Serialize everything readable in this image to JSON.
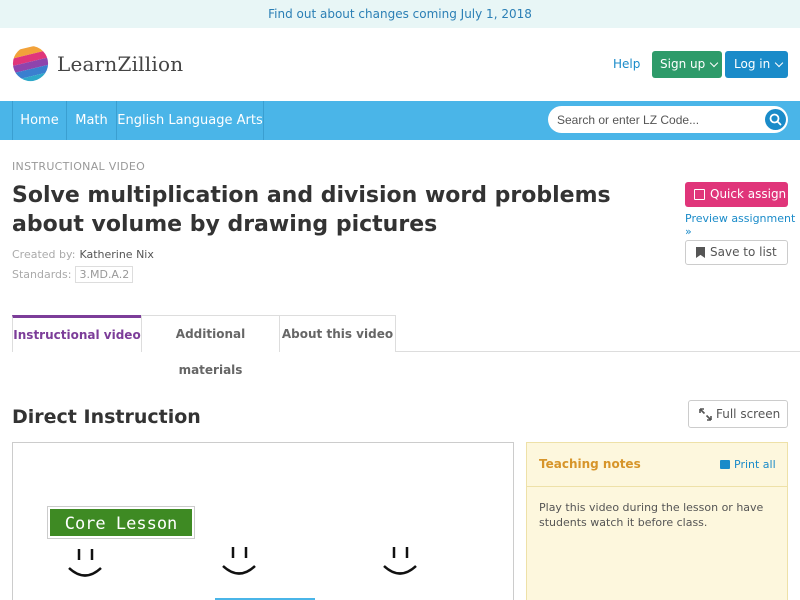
{
  "announcement": "Find out about changes coming July 1, 2018",
  "header": {
    "brand": "LearnZillion",
    "help": "Help",
    "signup": "Sign up",
    "login": "Log in"
  },
  "nav": {
    "items": [
      "Home",
      "Math",
      "English Language Arts"
    ]
  },
  "search": {
    "placeholder": "Search or enter LZ Code..."
  },
  "lesson": {
    "eyebrow": "INSTRUCTIONAL VIDEO",
    "title": "Solve multiplication and division word problems about volume by drawing pictures",
    "created_label": "Created by:",
    "author": "Katherine Nix",
    "standards_label": "Standards:",
    "standard": "3.MD.A.2"
  },
  "actions": {
    "quick_assign": "Quick assign",
    "preview": "Preview assignment »",
    "save": "Save to list"
  },
  "tabs": [
    "Instructional video",
    "Additional materials",
    "About this video"
  ],
  "section": {
    "title": "Direct Instruction",
    "fullscreen": "Full screen"
  },
  "video": {
    "badge": "Core Lesson"
  },
  "notes": {
    "title": "Teaching notes",
    "print": "Print all",
    "body": "Play this video during the lesson or have students watch it before class."
  },
  "colors": {
    "nav": "#4ab5e8",
    "signup": "#2e9b6a",
    "login": "#1a8bc9",
    "quick_assign": "#e0357a",
    "active_tab": "#7c3d99",
    "notes_bg": "#fdf7dd"
  }
}
